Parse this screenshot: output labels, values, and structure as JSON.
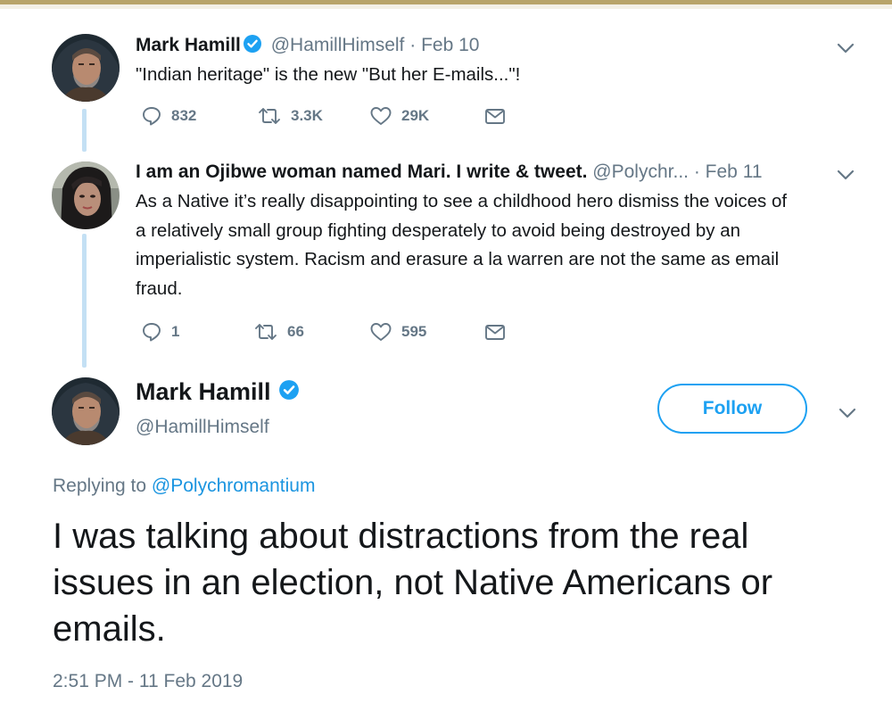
{
  "tweet1": {
    "name": "Mark Hamill",
    "handle": "@HamillHimself",
    "dot": "·",
    "date": "Feb 10",
    "text": "\"Indian heritage\" is the new \"But her E-mails...\"!",
    "replies": "832",
    "retweets": "3.3K",
    "likes": "29K"
  },
  "tweet2": {
    "name": "I am an Ojibwe woman named Mari. I write & tweet.",
    "handle": "@Polychr...",
    "dot": "·",
    "date": "Feb 11",
    "text_lines": [
      "As a Native it’s really disappointing to see a childhood hero dismiss the voices of",
      "a relatively small group fighting desperately to avoid being destroyed by an",
      "imperialistic system. Racism and erasure a la warren are not the same as email",
      "fraud."
    ],
    "replies": "1",
    "retweets": "66",
    "likes": "595"
  },
  "main": {
    "name": "Mark Hamill",
    "handle": "@HamillHimself",
    "follow_label": "Follow",
    "replying_prefix": "Replying to",
    "replying_to": "@Polychromantium",
    "text_lines": [
      "I was talking about distractions from the real",
      "issues in an election, not Native Americans or",
      "emails."
    ],
    "timestamp": "2:51 PM - 11 Feb 2019"
  },
  "colors": {
    "accent": "#1da1f2",
    "thread_line": "#c4e0f4",
    "muted": "#657786",
    "text": "#14171a"
  }
}
